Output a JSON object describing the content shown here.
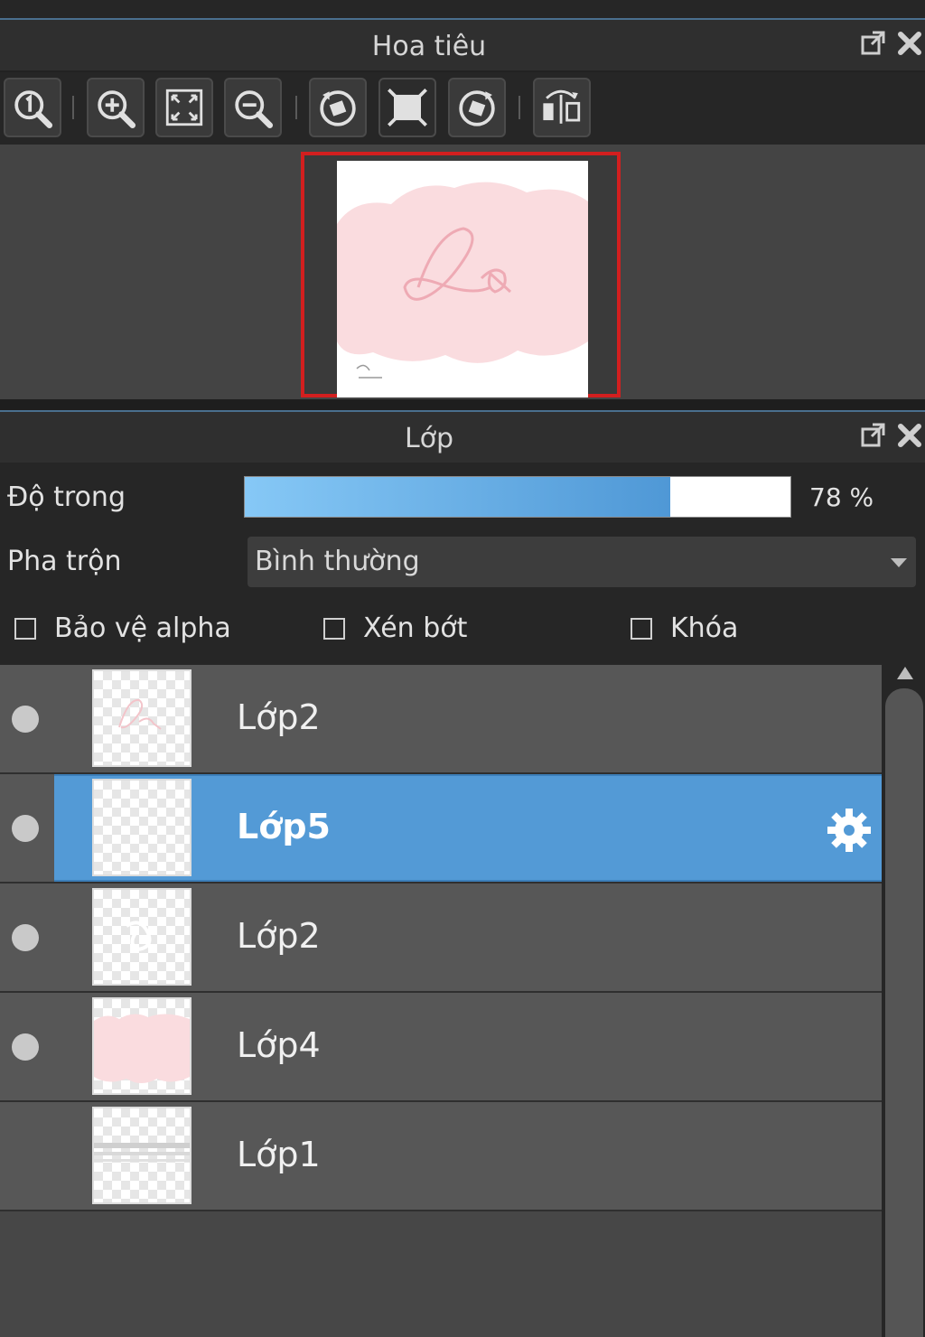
{
  "navigator": {
    "title": "Hoa tiêu",
    "toolbar_icons": [
      "zoom-actual-icon",
      "zoom-in-icon",
      "fit-screen-icon",
      "zoom-out-icon",
      "rotate-left-icon",
      "reset-view-icon",
      "rotate-right-icon",
      "flip-horizontal-icon"
    ]
  },
  "layers_panel": {
    "title": "Lớp",
    "opacity_label": "Độ trong",
    "opacity_percent": 78,
    "opacity_text": "78 %",
    "blend_label": "Pha trộn",
    "blend_value": "Bình thường",
    "checkboxes": [
      {
        "label": "Bảo vệ alpha",
        "checked": false
      },
      {
        "label": "Xén bớt",
        "checked": false
      },
      {
        "label": "Khóa",
        "checked": false
      }
    ],
    "layers": [
      {
        "name": "Lớp2",
        "visible": true,
        "selected": false
      },
      {
        "name": "Lớp5",
        "visible": true,
        "selected": true
      },
      {
        "name": "Lớp2",
        "visible": true,
        "selected": false
      },
      {
        "name": "Lớp4",
        "visible": true,
        "selected": false
      },
      {
        "name": "Lớp1",
        "visible": false,
        "selected": false
      }
    ]
  },
  "colors": {
    "accent_selected": "#539ad6",
    "preview_border": "#d21f1f",
    "opacity_gradient_start": "#86c8f6",
    "opacity_gradient_end": "#4f98d6"
  }
}
